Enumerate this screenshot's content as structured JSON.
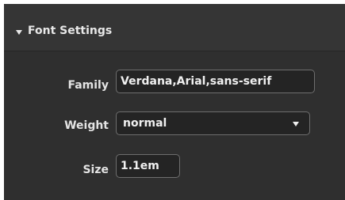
{
  "section": {
    "title": "Font Settings",
    "expanded_icon": "caret-down-icon"
  },
  "fields": {
    "family": {
      "label": "Family",
      "value": "Verdana,Arial,sans-serif"
    },
    "weight": {
      "label": "Weight",
      "value": "normal",
      "dropdown_icon": "chevron-down-icon"
    },
    "size": {
      "label": "Size",
      "value": "1.1em"
    }
  },
  "colors": {
    "panel_background": "#2f2f2f",
    "header_background": "#353535",
    "field_background": "#242424",
    "field_border": "#6e6e6e",
    "text": "#e8e8e8"
  }
}
